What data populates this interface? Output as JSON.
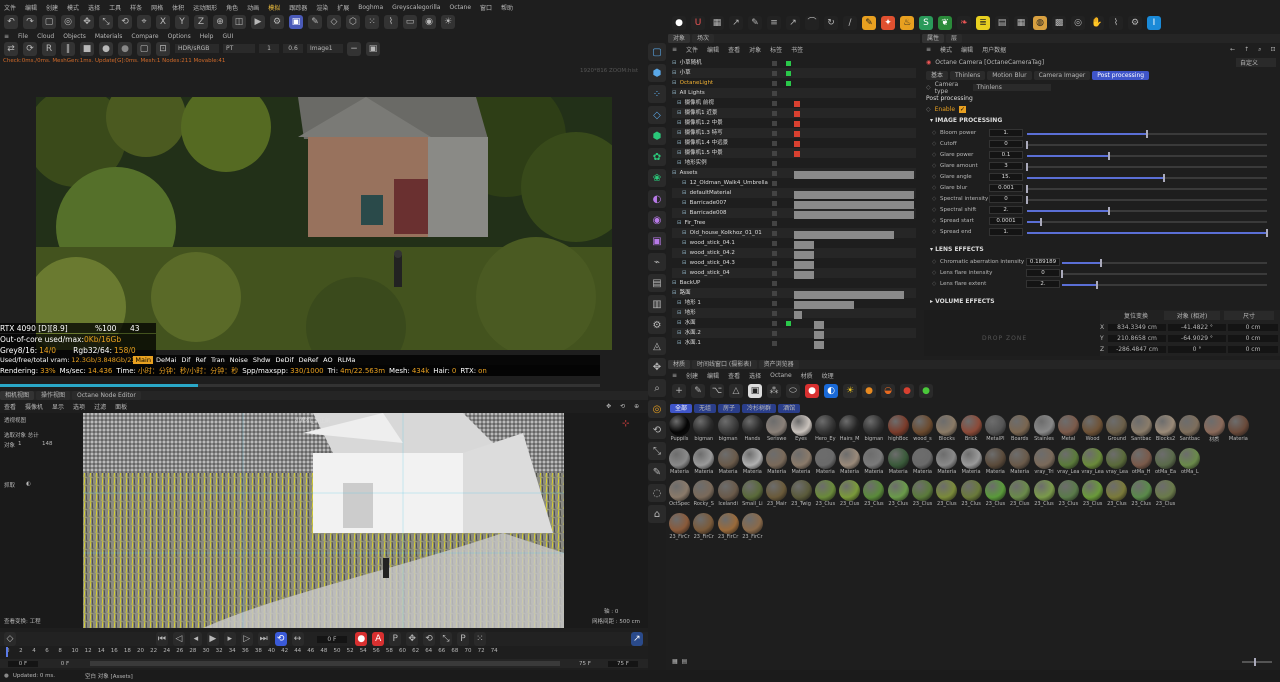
{
  "top_menu": [
    "文件",
    "编辑",
    "创建",
    "模式",
    "选择",
    "工具",
    "样条",
    "网格",
    "体积",
    "运动图形",
    "角色",
    "动画",
    "模拟",
    "跟踪器",
    "渲染",
    "扩展",
    "Boghma",
    "Greyscalegorilla",
    "Octane",
    "窗口",
    "帮助"
  ],
  "live_viewer": {
    "menu": [
      "File",
      "Cloud",
      "Objects",
      "Materials",
      "Compare",
      "Options",
      "Help",
      "GUI"
    ],
    "color_mode": "HDR/sRGB",
    "pt": "PT",
    "num1": "1",
    "num2": "0.6",
    "image_sel": "Image1",
    "status_line": "Check:0ms./0ms. MeshGen:1ms. Update[G]:0ms. Mesh:1 Nodes:211 Movable:41",
    "res_hint": "1920*816 ZOOM:hist",
    "stats": {
      "gpu": "RTX 4090 [D][8.9]",
      "pct": "%100",
      "cnt": "43",
      "out_of_core_label": "Out-of-core used/max:",
      "out_of_core_val": "0Kb/16Gb",
      "grey_label": "Grey8/16:",
      "grey_val": "14/0",
      "rgb_label": "Rgb32/64:",
      "rgb_val": "158/0",
      "vram_label": "Used/free/total vram:",
      "vram_val": "12.3Gb/3.848Gb/23.9",
      "passes": [
        "Main",
        "DeMai",
        "Dif",
        "Ref",
        "Tran",
        "Noise",
        "Shdw",
        "DeDif",
        "DeRef",
        "AO",
        "RLMa"
      ],
      "rendering_label": "Rendering:",
      "rendering_pct": "33%",
      "ms_label": "Ms/sec:",
      "ms_val": "14.436",
      "time_label": "Time:",
      "time_val": "小时：分钟：秒/小时：分钟：秒",
      "spp_label": "Spp/maxspp:",
      "spp_val": "330/1000",
      "tri_label": "Tri:",
      "tri_val": "4m/22.563m",
      "mesh_label": "Mesh:",
      "mesh_val": "434k",
      "hair_label": "Hair:",
      "hair_val": "0",
      "rtx_label": "RTX:",
      "rtx_val": "on"
    },
    "render_progress": 0.33
  },
  "viewport": {
    "tabs": [
      "相机视图",
      "操作视图",
      "Octane Node Editor"
    ],
    "menu": [
      "查看",
      "摄像机",
      "显示",
      "选项",
      "过滤",
      "面板"
    ],
    "camera_label": "透视视图",
    "cam_name": "小摩机_1 正前",
    "sel_total_label": "选取对象 总计",
    "obj_label": "对象",
    "obj_count": "1",
    "obj_total": "148",
    "grab_label": "抓取",
    "view_transform": "查看变换: 工程",
    "grid_spacing": "网格间距 : 500 cm",
    "axis": "轴 : 0"
  },
  "timeline": {
    "current_frame": "0 F",
    "ticks": [
      "0",
      "2",
      "4",
      "6",
      "8",
      "10",
      "12",
      "14",
      "16",
      "18",
      "20",
      "22",
      "24",
      "26",
      "28",
      "30",
      "32",
      "34",
      "36",
      "38",
      "40",
      "42",
      "44",
      "46",
      "48",
      "50",
      "52",
      "54",
      "56",
      "58",
      "60",
      "62",
      "64",
      "66",
      "68",
      "70",
      "72",
      "74"
    ],
    "start": "0 F",
    "start2": "0 F",
    "end": "75 F",
    "end2": "75 F",
    "status": "Updated: 0 ms.",
    "status2": "空白 对象 [Assets]"
  },
  "object_manager": {
    "tabs": [
      "对象",
      "场次"
    ],
    "menu": [
      "文件",
      "编辑",
      "查看",
      "对象",
      "标签",
      "书签"
    ],
    "rows": [
      {
        "name": "小草随机",
        "indent": 0,
        "color": "#ddd"
      },
      {
        "name": "小草",
        "indent": 0,
        "color": "#ddd"
      },
      {
        "name": "OctaneLight",
        "indent": 0,
        "color": "#f2b233"
      },
      {
        "name": "All Lights",
        "indent": 0,
        "color": "#ddd"
      },
      {
        "name": "摄像机 前视",
        "indent": 1,
        "color": "#ddd"
      },
      {
        "name": "摄像机1 近景",
        "indent": 1,
        "color": "#ddd"
      },
      {
        "name": "摄像机1.2 中景",
        "indent": 1,
        "color": "#ddd"
      },
      {
        "name": "摄像机1.3 特写",
        "indent": 1,
        "color": "#ddd"
      },
      {
        "name": "摄像机1.4 中远景",
        "indent": 1,
        "color": "#ddd"
      },
      {
        "name": "摄像机1.5 中景",
        "indent": 1,
        "color": "#ddd"
      },
      {
        "name": "地形实例",
        "indent": 1,
        "color": "#ddd"
      },
      {
        "name": "Assets",
        "indent": 0,
        "color": "#ddd"
      },
      {
        "name": "12_Oldman_Walk4_Umbrella",
        "indent": 2,
        "color": "#ddd"
      },
      {
        "name": "defaultMaterial",
        "indent": 2,
        "color": "#ddd"
      },
      {
        "name": "Barricade007",
        "indent": 2,
        "color": "#ddd"
      },
      {
        "name": "Barricade008",
        "indent": 2,
        "color": "#ddd"
      },
      {
        "name": "Fir_Tree",
        "indent": 1,
        "color": "#ddd"
      },
      {
        "name": "Old_house_Kolkhoz_01_01",
        "indent": 2,
        "color": "#ddd"
      },
      {
        "name": "wood_stick_04.1",
        "indent": 2,
        "color": "#ddd"
      },
      {
        "name": "wood_stick_04.2",
        "indent": 2,
        "color": "#ddd"
      },
      {
        "name": "wood_stick_04.3",
        "indent": 2,
        "color": "#ddd"
      },
      {
        "name": "wood_stick_04",
        "indent": 2,
        "color": "#ddd"
      },
      {
        "name": "BackUP",
        "indent": 0,
        "color": "#ddd"
      },
      {
        "name": "路面",
        "indent": 0,
        "color": "#ddd"
      },
      {
        "name": "地形 1",
        "indent": 1,
        "color": "#ddd"
      },
      {
        "name": "地形",
        "indent": 1,
        "color": "#ddd"
      },
      {
        "name": "水面",
        "indent": 1,
        "color": "#ddd"
      },
      {
        "name": "水面.2",
        "indent": 1,
        "color": "#ddd"
      },
      {
        "name": "水面.1",
        "indent": 1,
        "color": "#ddd"
      }
    ]
  },
  "attributes": {
    "tabs": [
      "属性",
      "层"
    ],
    "menu": [
      "模式",
      "编辑",
      "用户数据"
    ],
    "title": "Octane Camera [OctaneCameraTag]",
    "preset": "自定义",
    "subtabs": [
      "基本",
      "Thinlens",
      "Motion Blur",
      "Camera Imager",
      "Post processing"
    ],
    "camera_type_label": "Camera type",
    "camera_type": "Thinlens",
    "section": "Post processing",
    "enable_label": "Enable",
    "image_processing": "IMAGE PROCESSING",
    "params": [
      {
        "label": "Bloom power",
        "value": "1.",
        "frac": 0.5
      },
      {
        "label": "Cutoff",
        "value": "0",
        "frac": 0
      },
      {
        "label": "Glare power",
        "value": "0.1",
        "frac": 0.34
      },
      {
        "label": "Glare amount",
        "value": "3",
        "frac": 0
      },
      {
        "label": "Glare angle",
        "value": "15.",
        "frac": 0.57
      },
      {
        "label": "Glare blur",
        "value": "0.001",
        "frac": 0
      },
      {
        "label": "Spectral intensity",
        "value": "0",
        "frac": 0
      },
      {
        "label": "Spectral shift",
        "value": "2.",
        "frac": 0.34
      },
      {
        "label": "Spread start",
        "value": "0.0001",
        "frac": 0.06
      },
      {
        "label": "Spread end",
        "value": "1.",
        "frac": 1.0
      }
    ],
    "lens_effects": "LENS EFFECTS",
    "lens_params": [
      {
        "label": "Chromatic aberration intensity",
        "value": "0.189189",
        "frac": 0.19
      },
      {
        "label": "Lens flare intensity",
        "value": "0",
        "frac": 0
      },
      {
        "label": "Lens flare extent",
        "value": "2.",
        "frac": 0.17
      }
    ],
    "volume_effects": "VOLUME EFFECTS",
    "drop_zone": "DROP ZONE"
  },
  "coordinates": {
    "headers": [
      "复位变换",
      "对象 (相对)",
      "尺寸"
    ],
    "rows": [
      {
        "axis": "X",
        "pos": "834.3349 cm",
        "rot": "-41.4822 °",
        "size": "0 cm"
      },
      {
        "axis": "Y",
        "pos": "210.8658 cm",
        "rot": "-64.9029 °",
        "size": "0 cm"
      },
      {
        "axis": "Z",
        "pos": "-286.4847 cm",
        "rot": "0 °",
        "size": "0 cm"
      }
    ]
  },
  "material_manager": {
    "tabs": [
      "材质",
      "时间线窗口 (摄影表)",
      "资产浏览器"
    ],
    "menu": [
      "创建",
      "编辑",
      "查看",
      "选择",
      "Octane",
      "材质",
      "纹理"
    ],
    "filters": [
      "全部",
      "无组",
      "房子",
      "冷杉树群",
      "酒馆"
    ],
    "materials": [
      {
        "name": "Puppils",
        "color": "#050505"
      },
      {
        "name": "bigman",
        "color": "#2a2a2a"
      },
      {
        "name": "bigman",
        "color": "#3a3a3a"
      },
      {
        "name": "Hands",
        "color": "#2b2b2b"
      },
      {
        "name": "Seriswe",
        "color": "#8a8078"
      },
      {
        "name": "Eyes",
        "color": "#c9c2bc"
      },
      {
        "name": "Hero_Ey",
        "color": "#333"
      },
      {
        "name": "Hairs_M",
        "color": "#252525"
      },
      {
        "name": "bigman",
        "color": "#2f2f2f"
      },
      {
        "name": "highBoc",
        "color": "#7a3b2a"
      },
      {
        "name": "wood_s",
        "color": "#6b4a2e"
      },
      {
        "name": "Blocks",
        "color": "#8a7a66"
      },
      {
        "name": "Brick",
        "color": "#8c4a38"
      },
      {
        "name": "MetalPl",
        "color": "#555"
      },
      {
        "name": "Boards",
        "color": "#7a6650"
      },
      {
        "name": "Stainles",
        "color": "#888"
      },
      {
        "name": "Metal",
        "color": "#7b5a4a"
      },
      {
        "name": "Wood",
        "color": "#6e5236"
      },
      {
        "name": "Ground",
        "color": "#6b5e48"
      },
      {
        "name": "Santbac",
        "color": "#8a7c6a"
      },
      {
        "name": "Blocks2",
        "color": "#9a8a78"
      },
      {
        "name": "Santbac",
        "color": "#7e6e5c"
      },
      {
        "name": "材质",
        "color": "#8a6a5a"
      },
      {
        "name": "Materia",
        "color": "#6a4a3a"
      },
      {
        "name": "Materia",
        "color": "#8a8a8a"
      },
      {
        "name": "Materia",
        "color": "#9a9a9a"
      },
      {
        "name": "Materia",
        "color": "#6a5a4a"
      },
      {
        "name": "Materia",
        "color": "#b0b0b0"
      },
      {
        "name": "Materia",
        "color": "#7a6a5a"
      },
      {
        "name": "Materia",
        "color": "#8a7a6a"
      },
      {
        "name": "Materia",
        "color": "#6a6a6a"
      },
      {
        "name": "Materia",
        "color": "#9a8a7a"
      },
      {
        "name": "Materia",
        "color": "#7a7a7a"
      },
      {
        "name": "Materia",
        "color": "#3a5a3a"
      },
      {
        "name": "Materia",
        "color": "#6a6a6a"
      },
      {
        "name": "Materia",
        "color": "#8a8a8a"
      },
      {
        "name": "Materia",
        "color": "#9a9a9a"
      },
      {
        "name": "Materia",
        "color": "#5a4a3a"
      },
      {
        "name": "Materia",
        "color": "#6a5a4a"
      },
      {
        "name": "vray_Tri",
        "color": "#7a6a5a"
      },
      {
        "name": "vray_Lea",
        "color": "#5a7a3a"
      },
      {
        "name": "vray_Lea",
        "color": "#6a8a3a"
      },
      {
        "name": "vray_Lea",
        "color": "#5a6a3a"
      },
      {
        "name": "otMa_H",
        "color": "#7a5a4a"
      },
      {
        "name": "otMa_Ea",
        "color": "#5a6a4a"
      },
      {
        "name": "otMa_L",
        "color": "#6a8a4a"
      },
      {
        "name": "OctSpec",
        "color": "#8a7a6a"
      },
      {
        "name": "Rocky_S",
        "color": "#7a6a5a"
      },
      {
        "name": "Icelandi",
        "color": "#6a5a4a"
      },
      {
        "name": "Small_Li",
        "color": "#5a6a3a"
      },
      {
        "name": "23_Mair",
        "color": "#6a5a3a"
      },
      {
        "name": "23_Twig",
        "color": "#5a5a3a"
      },
      {
        "name": "23_Clus",
        "color": "#6a8a3a"
      },
      {
        "name": "23_Clus",
        "color": "#7a9a3a"
      },
      {
        "name": "23_Clus",
        "color": "#5a8a3a"
      },
      {
        "name": "23_Clus",
        "color": "#6a9a4a"
      },
      {
        "name": "23_Clus",
        "color": "#5a7a3a"
      },
      {
        "name": "23_Clus",
        "color": "#7a8a3a"
      },
      {
        "name": "23_Clus",
        "color": "#6a7a3a"
      },
      {
        "name": "23_Clus",
        "color": "#5a9a3a"
      },
      {
        "name": "23_Clus",
        "color": "#6a8a4a"
      },
      {
        "name": "23_Clus",
        "color": "#7a9a4a"
      },
      {
        "name": "23_Clus",
        "color": "#5a7a4a"
      },
      {
        "name": "23_Clus",
        "color": "#6a9a3a"
      },
      {
        "name": "23_Clus",
        "color": "#7a7a3a"
      },
      {
        "name": "23_Clus",
        "color": "#5a8a4a"
      },
      {
        "name": "23_Clus",
        "color": "#6a7a4a"
      },
      {
        "name": "23_FirCr",
        "color": "#8a5a3a"
      },
      {
        "name": "23_FirCr",
        "color": "#7a5a3a"
      },
      {
        "name": "23_FirCr",
        "color": "#9a6a3a"
      },
      {
        "name": "23_FirCr",
        "color": "#8a6a4a"
      }
    ]
  }
}
